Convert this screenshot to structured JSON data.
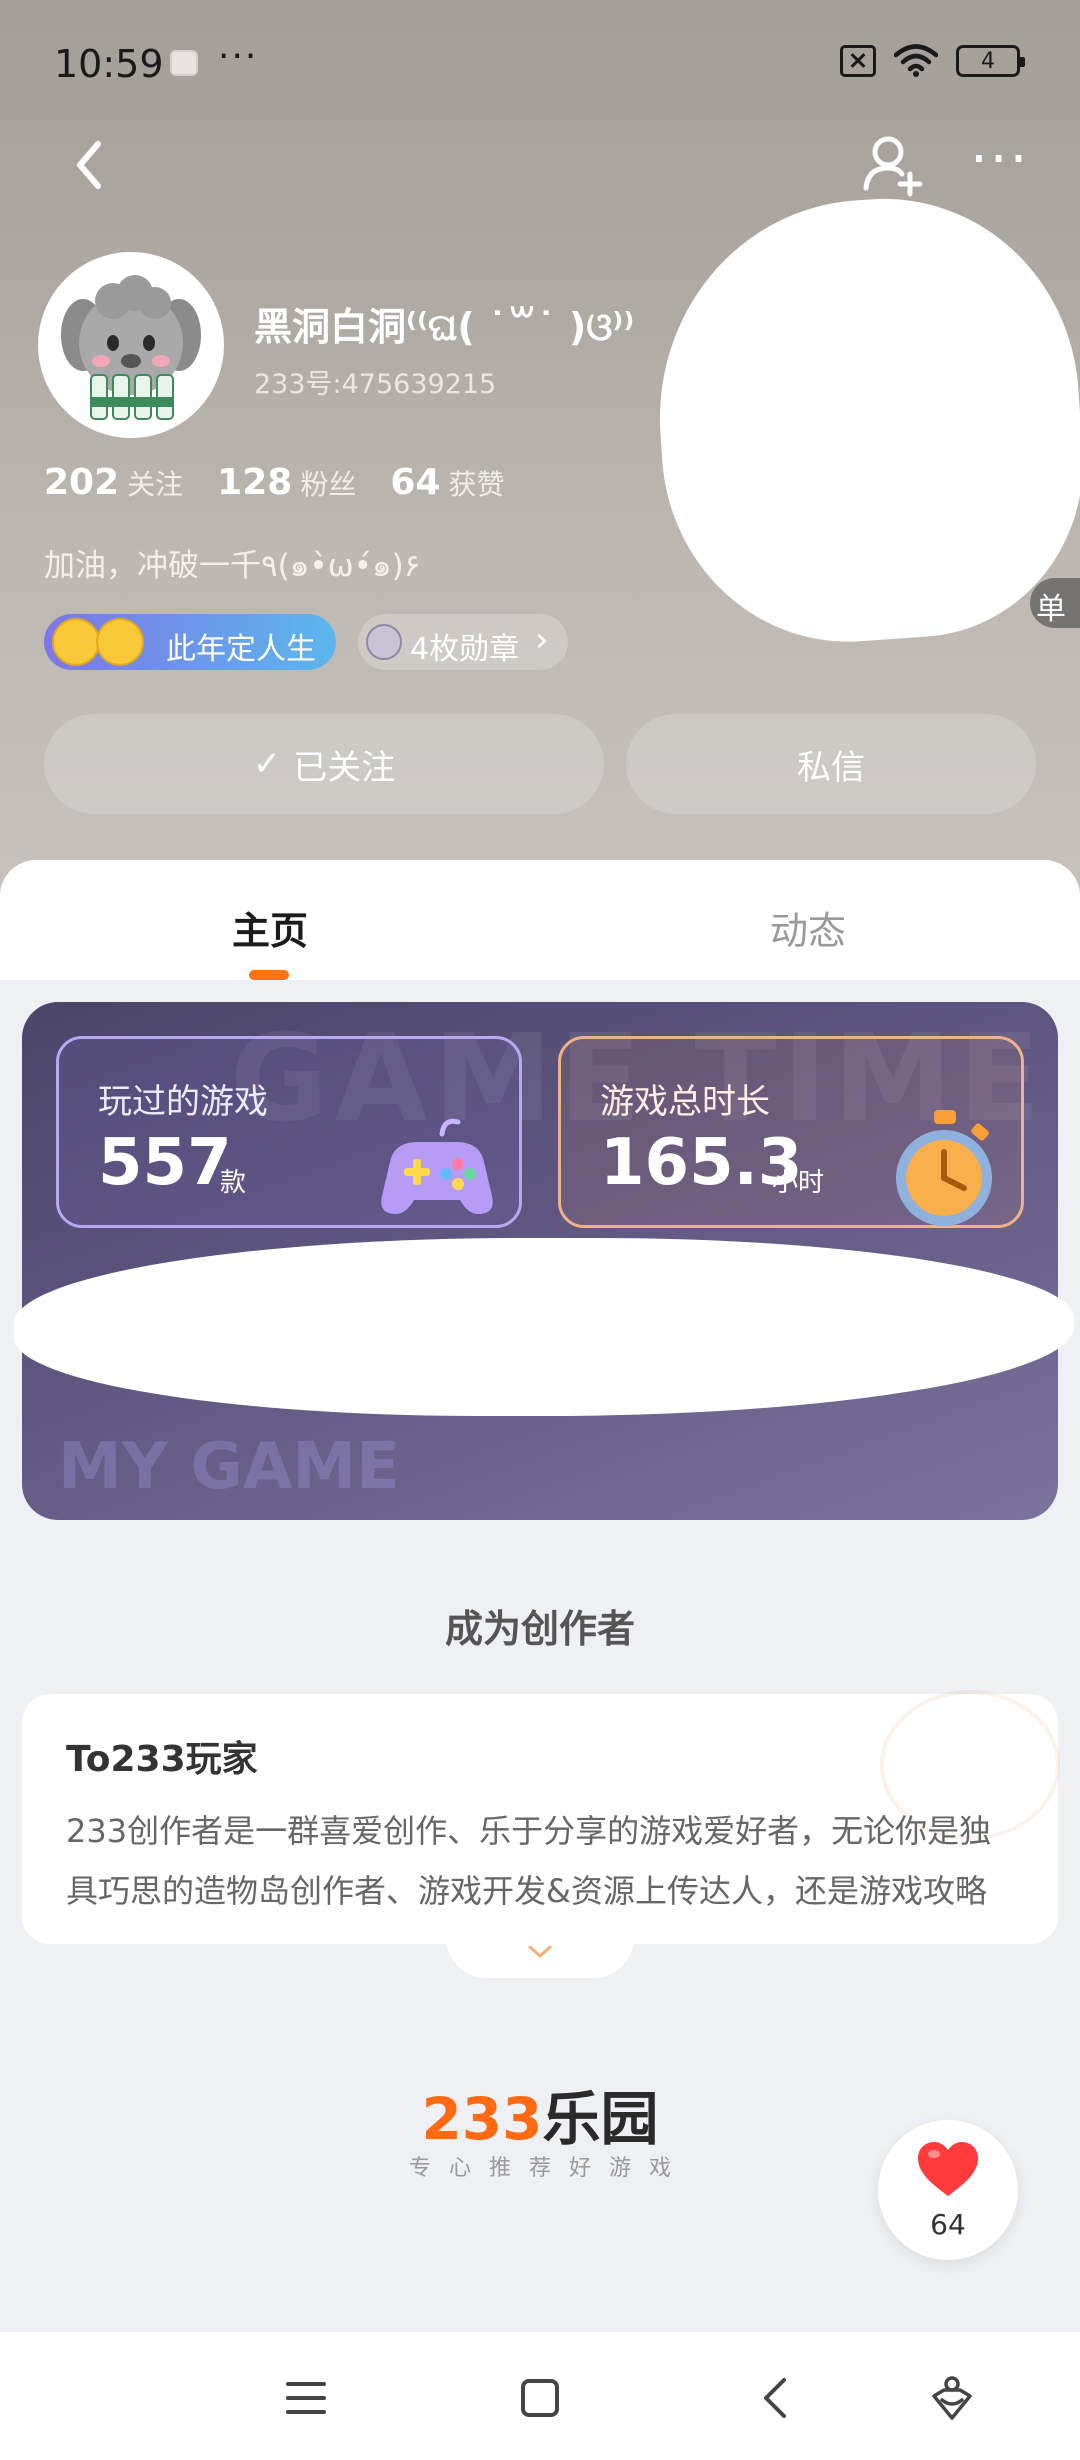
{
  "status_bar": {
    "time": "10:59",
    "dots": "···",
    "battery": "4"
  },
  "header": {
    "more_label": "···"
  },
  "profile": {
    "nickname": "黑洞白洞⁽⁽ଘ( ˙꒳˙ )ଓ⁾⁾",
    "user_id": "233号:475639215",
    "stats": {
      "following_count": "202",
      "following_label": "关注",
      "followers_count": "128",
      "followers_label": "粉丝",
      "likes_count": "64",
      "likes_label": "获赞"
    },
    "bio": "加油，冲破一千٩(๑•̀ω•́๑)۶",
    "title_badge": "此年定人生",
    "medal_badge": "4枚勋章",
    "medal_chevron": "›",
    "right_pill_text": "单",
    "follow_button": "已关注",
    "follow_check": "✓",
    "message_button": "私信"
  },
  "tabs": {
    "home": "主页",
    "feed": "动态"
  },
  "game_card": {
    "watermark_top": "GAME TIME",
    "watermark_bottom": "MY GAME",
    "played_label": "玩过的游戏",
    "played_value": "557",
    "played_unit": "款",
    "time_label": "游戏总时长",
    "time_value": "165.3",
    "time_unit": "小时"
  },
  "creator": {
    "heading": "成为创作者",
    "title": "To233玩家",
    "line1": "233创作者是一群喜爱创作、乐于分享的游戏爱好者，无论你是独",
    "line2": "具巧思的造物岛创作者、游戏开发&资源上传达人，还是游戏攻略"
  },
  "logo": {
    "num": "233",
    "cn": "乐园",
    "slogan": "专心推荐好游戏"
  },
  "like": {
    "count": "64"
  },
  "colors": {
    "accent": "#ff7210",
    "card_bg": "#5f5780",
    "like_red": "#ff3b3b"
  }
}
